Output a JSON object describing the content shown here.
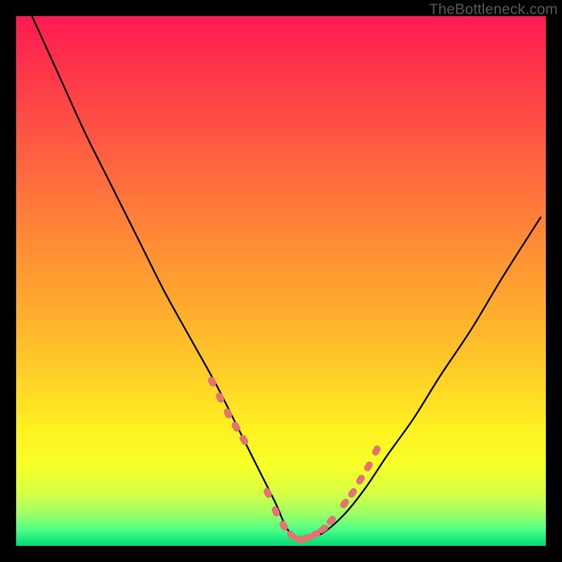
{
  "watermark": "TheBottleneck.com",
  "colors": {
    "frame": "#000000",
    "curve_stroke": "#000000",
    "marker_fill": "#e57373",
    "marker_stroke": "#d86a6a"
  },
  "chart_data": {
    "type": "line",
    "title": "",
    "xlabel": "",
    "ylabel": "",
    "xlim": [
      0,
      100
    ],
    "ylim": [
      0,
      100
    ],
    "grid": false,
    "notes": "Bottleneck-style V curve on rainbow gradient. y≈100 is top (red), y≈0 is bottom (green). Minimum near x≈53.",
    "series": [
      {
        "name": "bottleneck-curve",
        "x": [
          3,
          8,
          13,
          18,
          23,
          28,
          33,
          38,
          42,
          46,
          49,
          51,
          53,
          55,
          58,
          62,
          66,
          70,
          75,
          80,
          86,
          92,
          99
        ],
        "y": [
          100,
          89,
          78,
          68,
          58,
          48,
          39,
          30,
          22,
          14,
          8,
          3.5,
          1.2,
          1.4,
          2.5,
          6,
          11,
          17,
          24,
          32,
          41,
          51,
          62
        ]
      }
    ],
    "markers": {
      "name": "highlight-points",
      "note": "Decorative salmon tick markers clustered on the two flanks and the trough of the V.",
      "x": [
        37,
        38.5,
        40,
        41.5,
        43,
        47.5,
        49,
        50.5,
        52,
        53.5,
        55,
        56.5,
        58,
        59.5,
        62,
        63.5,
        65,
        66.5,
        68
      ],
      "y": [
        31,
        28,
        25,
        22.5,
        20,
        10,
        6.5,
        3.8,
        2,
        1.2,
        1.5,
        2.2,
        3.2,
        4.8,
        8,
        10,
        12.5,
        15,
        18
      ]
    }
  }
}
